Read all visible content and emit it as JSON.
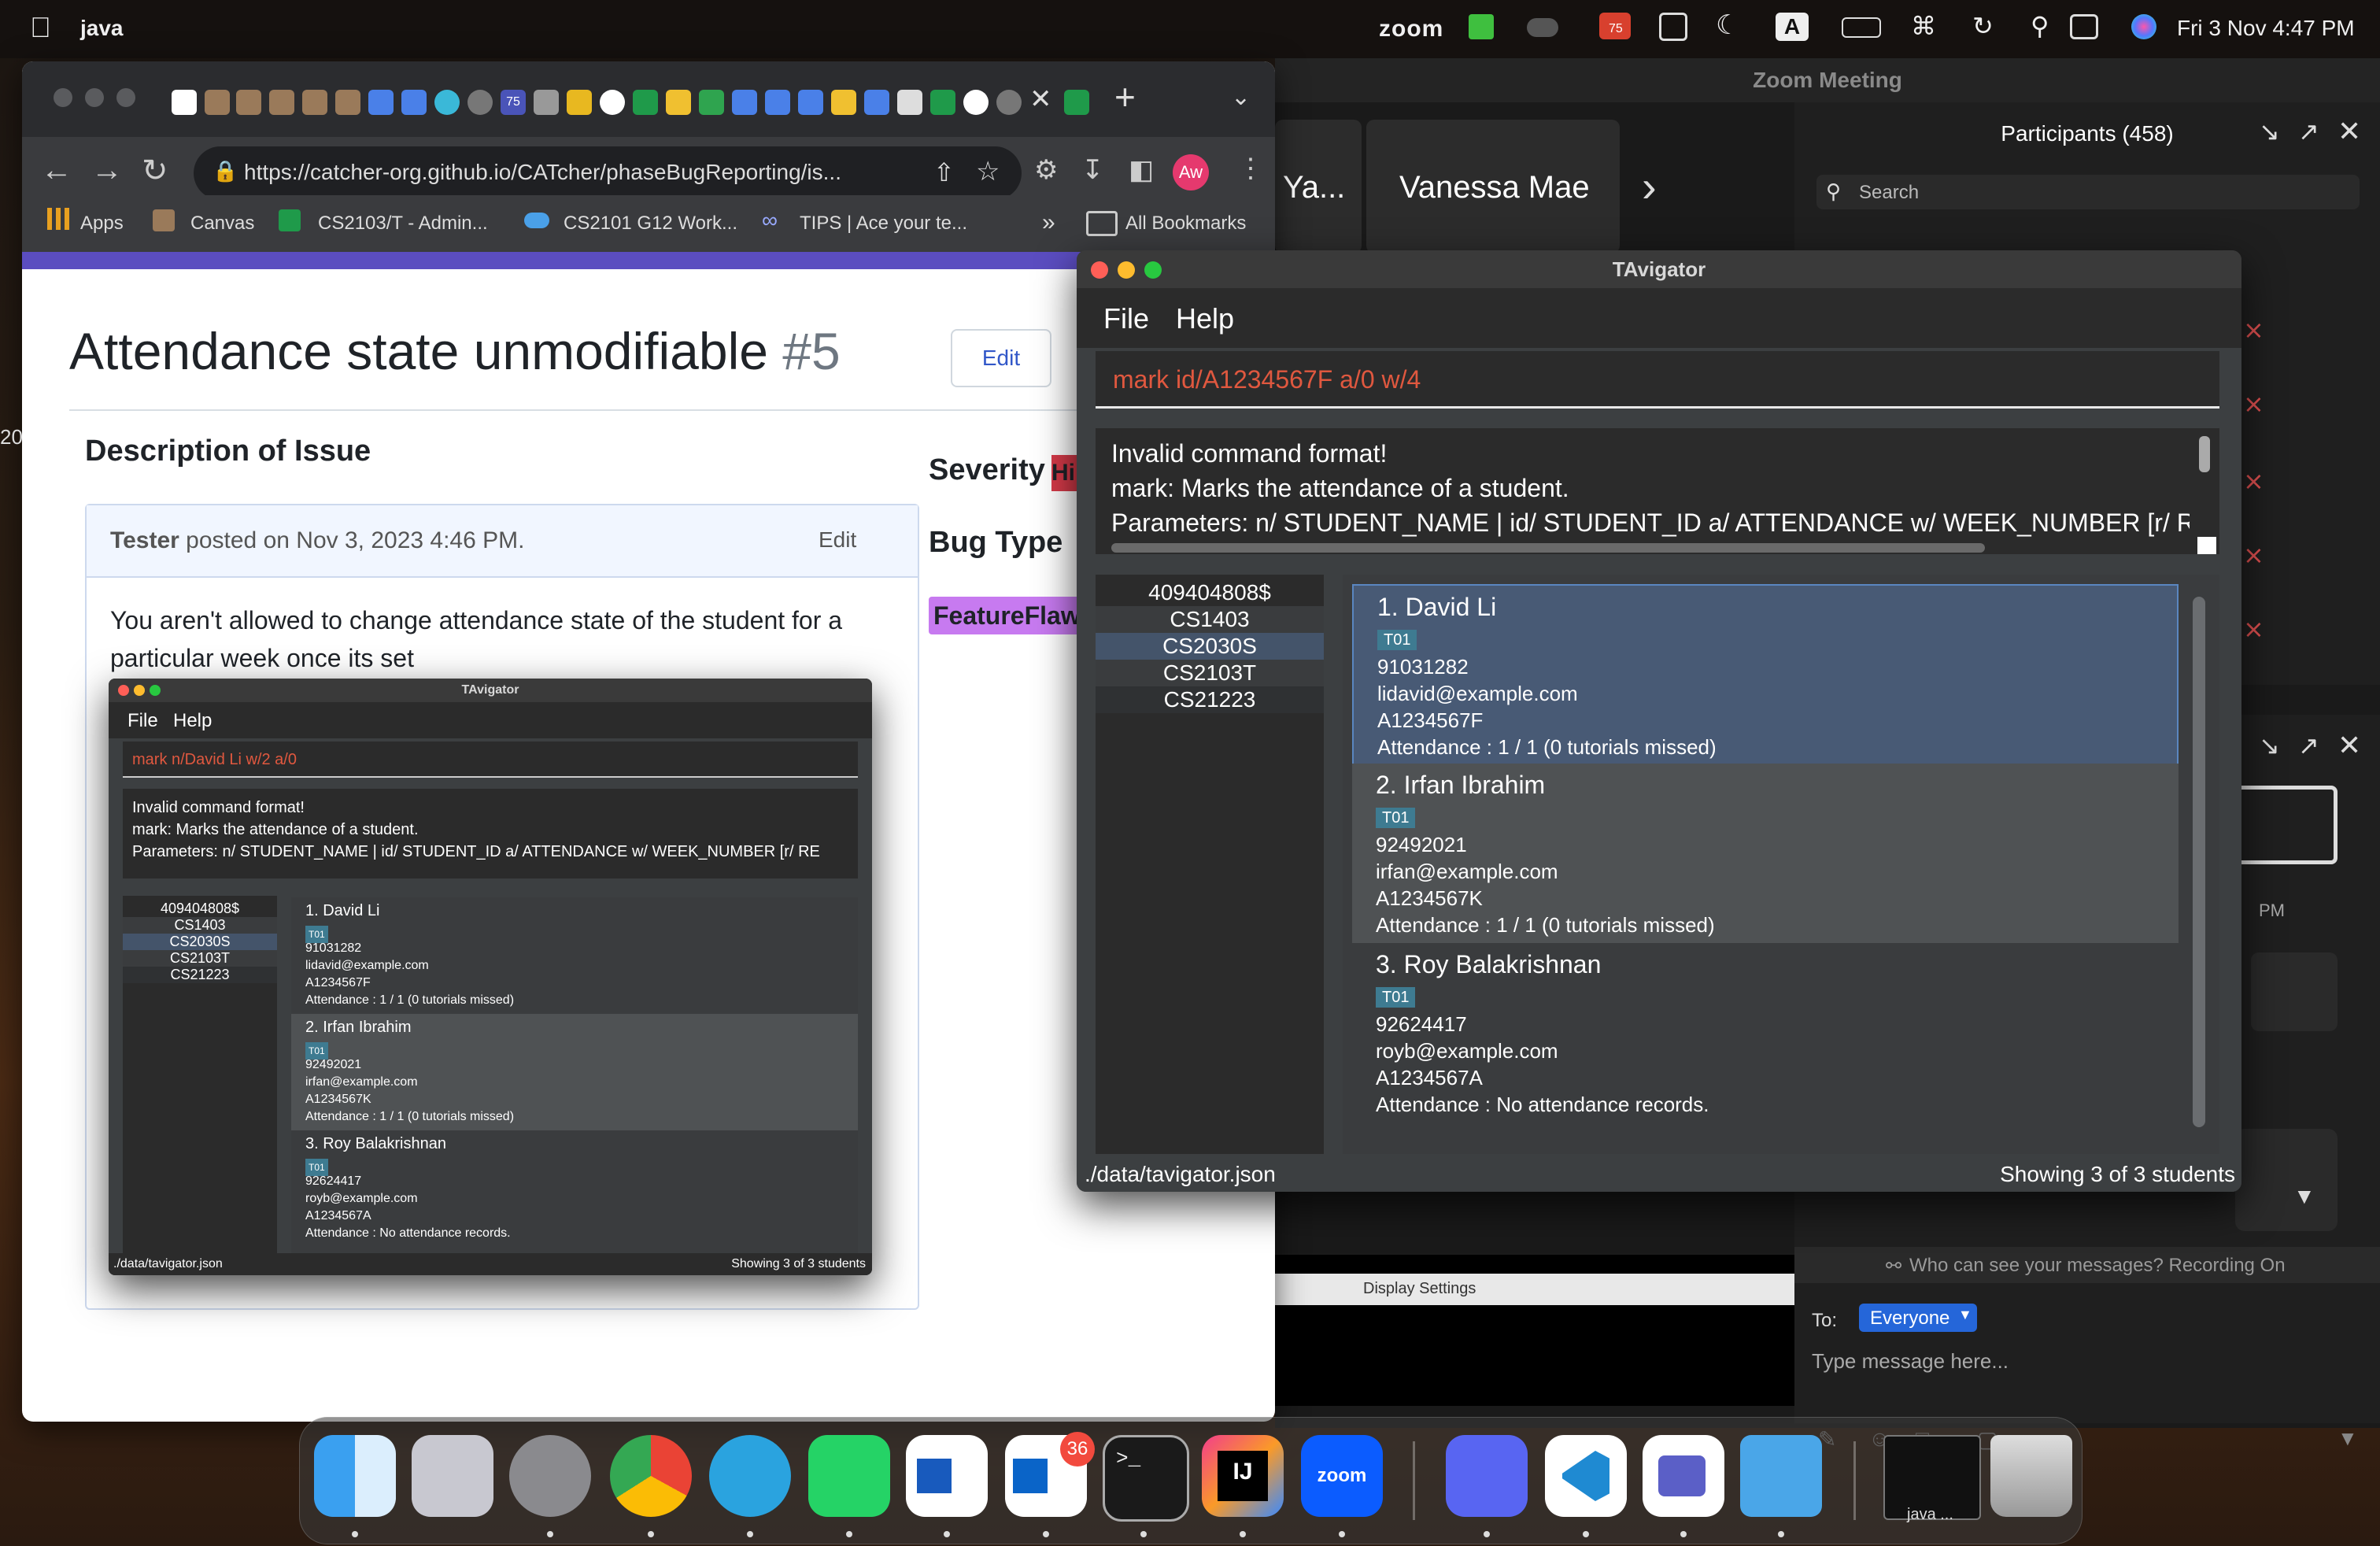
{
  "menubar": {
    "app_name": "java",
    "zoom_label": "zoom",
    "badge_count": "75",
    "input_source": "A",
    "datetime": "Fri 3 Nov  4:47 PM"
  },
  "chrome": {
    "url": "https://catcher-org.github.io/CATcher/phaseBugReporting/is...",
    "avatar": "Aw",
    "tab_badge": "75",
    "bookmarks": [
      "Apps",
      "Canvas",
      "CS2103/T - Admin...",
      "CS2101 G12 Work...",
      "TIPS | Ace your te..."
    ],
    "more": "»",
    "all_bookmarks": "All Bookmarks"
  },
  "issue": {
    "title": "Attendance state unmodifiable",
    "number": "#5",
    "edit_label": "Edit",
    "description_heading": "Description of Issue",
    "author": "Tester",
    "posted": "posted on Nov 3, 2023 4:46 PM.",
    "comment_edit": "Edit",
    "body": "You aren't allowed to change attendance state of the student for a particular week once its set",
    "severity_label": "Severity",
    "severity_value": "Hi",
    "bug_type_label": "Bug Type",
    "bug_type_value": "FeatureFlaw"
  },
  "tavigator_small": {
    "title": "TAvigator",
    "menu": [
      "File",
      "Help"
    ],
    "command": "mark n/David Li w/2 a/0",
    "result_lines": [
      "Invalid command format!",
      "mark: Marks the attendance of a student.",
      "Parameters: n/ STUDENT_NAME | id/ STUDENT_ID a/ ATTENDANCE w/ WEEK_NUMBER [r/ RE"
    ],
    "groups": [
      "409404808$",
      "CS1403",
      "CS2030S",
      "CS2103T",
      "CS21223"
    ],
    "footer_path": "./data/tavigator.json",
    "footer_count": "Showing 3 of 3 students"
  },
  "tavigator": {
    "title": "TAvigator",
    "menu": [
      "File",
      "Help"
    ],
    "command": "mark id/A1234567F a/0 w/4",
    "result_lines": [
      "Invalid command format!",
      "mark: Marks the attendance of a student.",
      "Parameters: n/ STUDENT_NAME | id/ STUDENT_ID a/ ATTENDANCE w/ WEEK_NUMBER [r/ RE"
    ],
    "groups": [
      "409404808$",
      "CS1403",
      "CS2030S",
      "CS2103T",
      "CS21223"
    ],
    "students": [
      {
        "header": "1.  David Li",
        "tag": "T01",
        "phone": "91031282",
        "email": "lidavid@example.com",
        "id": "A1234567F",
        "attendance": "Attendance : 1 / 1 (0 tutorials missed)"
      },
      {
        "header": "2.  Irfan Ibrahim",
        "tag": "T01",
        "phone": "92492021",
        "email": "irfan@example.com",
        "id": "A1234567K",
        "attendance": "Attendance : 1 / 1 (0 tutorials missed)"
      },
      {
        "header": "3.  Roy Balakrishnan",
        "tag": "T01",
        "phone": "92624417",
        "email": "royb@example.com",
        "id": "A1234567A",
        "attendance": "Attendance : No attendance records."
      }
    ],
    "footer_path": "./data/tavigator.json",
    "footer_count": "Showing 3 of 3 students"
  },
  "zoom": {
    "title": "Zoom Meeting",
    "tile_left": "Ya...",
    "tile_name": "Vanessa Mae",
    "next": "›",
    "participants_title": "Participants (458)",
    "search_placeholder": "Search",
    "time_fragment": "PM",
    "letter_fragment": "e",
    "display_settings": "Display Settings",
    "recording_notice": "Who can see your messages? Recording On",
    "to_label": "To:",
    "to_value": "Everyone",
    "message_placeholder": "Type message here...",
    "more": "···",
    "side_num": "20"
  },
  "dock": {
    "outlook_badge": "36",
    "intellij_label": "IJ",
    "zoom_label": "zoom",
    "java_label": "java ..."
  }
}
